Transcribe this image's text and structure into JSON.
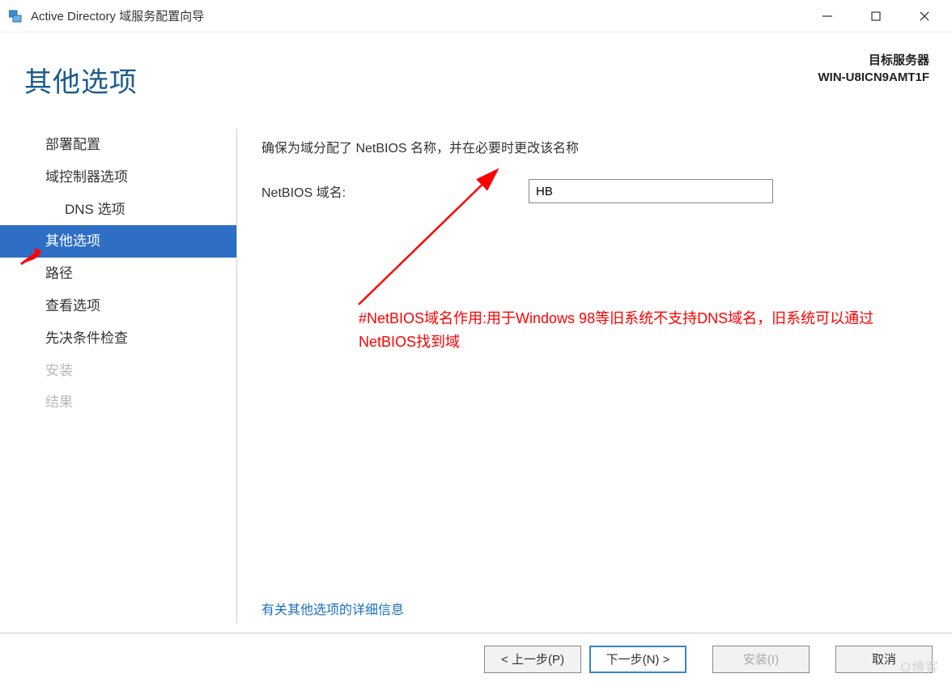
{
  "window": {
    "title": "Active Directory 域服务配置向导"
  },
  "header": {
    "page_title": "其他选项",
    "target_label": "目标服务器",
    "target_name": "WIN-U8ICN9AMT1F"
  },
  "sidebar": {
    "items": [
      {
        "label": "部署配置",
        "active": false,
        "disabled": false,
        "sub": false
      },
      {
        "label": "域控制器选项",
        "active": false,
        "disabled": false,
        "sub": false
      },
      {
        "label": "DNS 选项",
        "active": false,
        "disabled": false,
        "sub": true
      },
      {
        "label": "其他选项",
        "active": true,
        "disabled": false,
        "sub": false
      },
      {
        "label": "路径",
        "active": false,
        "disabled": false,
        "sub": false
      },
      {
        "label": "查看选项",
        "active": false,
        "disabled": false,
        "sub": false
      },
      {
        "label": "先决条件检查",
        "active": false,
        "disabled": false,
        "sub": false
      },
      {
        "label": "安装",
        "active": false,
        "disabled": true,
        "sub": false
      },
      {
        "label": "结果",
        "active": false,
        "disabled": true,
        "sub": false
      }
    ]
  },
  "main": {
    "instruction": "确保为域分配了 NetBIOS 名称，并在必要时更改该名称",
    "field_label": "NetBIOS 域名:",
    "field_value": "HB",
    "annotation": "#NetBIOS域名作用:用于Windows 98等旧系统不支持DNS域名，旧系统可以通过NetBIOS找到域",
    "more_info_link": "有关其他选项的详细信息"
  },
  "buttons": {
    "prev": "< 上一步(P)",
    "next": "下一步(N) >",
    "install": "安装(I)",
    "cancel": "取消"
  },
  "watermark": "O博客"
}
